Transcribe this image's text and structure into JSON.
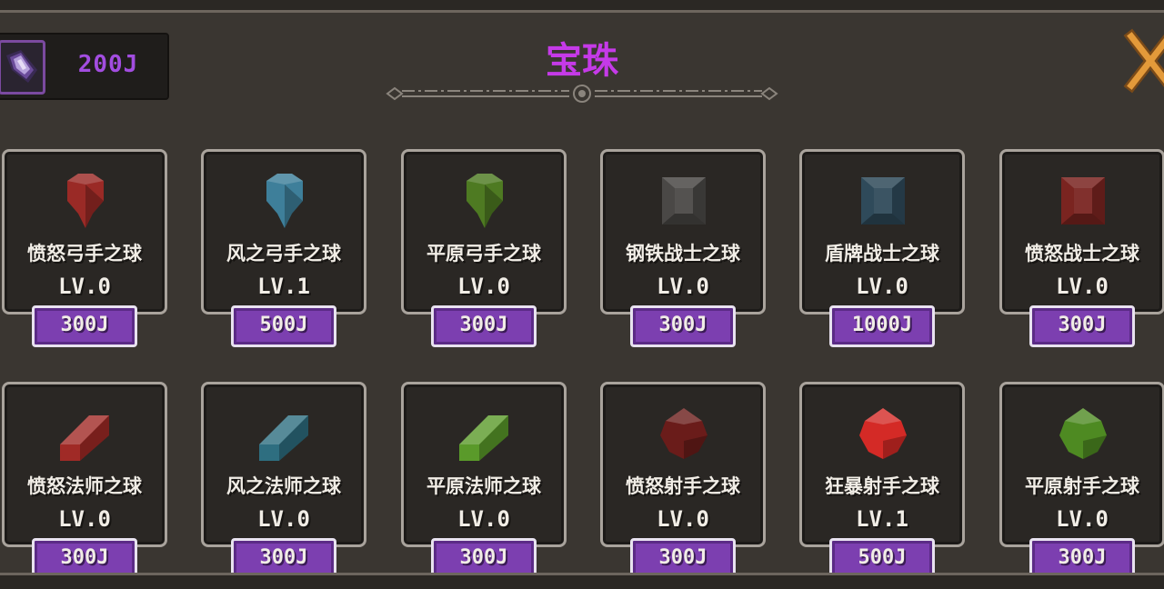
{
  "header": {
    "title": "宝珠",
    "currency_amount": "200J",
    "currency_icon": "purple-gem-icon",
    "close_icon": "close-x-icon"
  },
  "colors": {
    "title": "#c53ae8",
    "currency": "#a24de0",
    "price_button": "#7c3fb0",
    "card_border": "#a9a39c",
    "background": "#3a3631"
  },
  "orbs": [
    {
      "name": "愤怒弓手之球",
      "level": "LV.0",
      "price": "300J",
      "icon": "red-arrowhead-gem-icon",
      "color": "#9a2a26"
    },
    {
      "name": "风之弓手之球",
      "level": "LV.1",
      "price": "500J",
      "icon": "blue-arrowhead-gem-icon",
      "color": "#3e7f9a"
    },
    {
      "name": "平原弓手之球",
      "level": "LV.0",
      "price": "300J",
      "icon": "green-arrowhead-gem-icon",
      "color": "#4e7a22"
    },
    {
      "name": "钢铁战士之球",
      "level": "LV.0",
      "price": "300J",
      "icon": "gray-square-gem-icon",
      "color": "#4a4846"
    },
    {
      "name": "盾牌战士之球",
      "level": "LV.0",
      "price": "1000J",
      "icon": "teal-square-gem-icon",
      "color": "#2f4a5a"
    },
    {
      "name": "愤怒战士之球",
      "level": "LV.0",
      "price": "300J",
      "icon": "red-square-gem-icon",
      "color": "#7a2420"
    },
    {
      "name": "愤怒法师之球",
      "level": "LV.0",
      "price": "300J",
      "icon": "red-bar-gem-icon",
      "color": "#a02a26"
    },
    {
      "name": "风之法师之球",
      "level": "LV.0",
      "price": "300J",
      "icon": "teal-bar-gem-icon",
      "color": "#2e6e80"
    },
    {
      "name": "平原法师之球",
      "level": "LV.0",
      "price": "300J",
      "icon": "green-bar-gem-icon",
      "color": "#5a9a2a"
    },
    {
      "name": "愤怒射手之球",
      "level": "LV.0",
      "price": "300J",
      "icon": "dark-red-round-gem-icon",
      "color": "#6a1c1a"
    },
    {
      "name": "狂暴射手之球",
      "level": "LV.1",
      "price": "500J",
      "icon": "bright-red-round-gem-icon",
      "color": "#d42a26"
    },
    {
      "name": "平原射手之球",
      "level": "LV.0",
      "price": "300J",
      "icon": "green-round-gem-icon",
      "color": "#4e8a22"
    }
  ]
}
